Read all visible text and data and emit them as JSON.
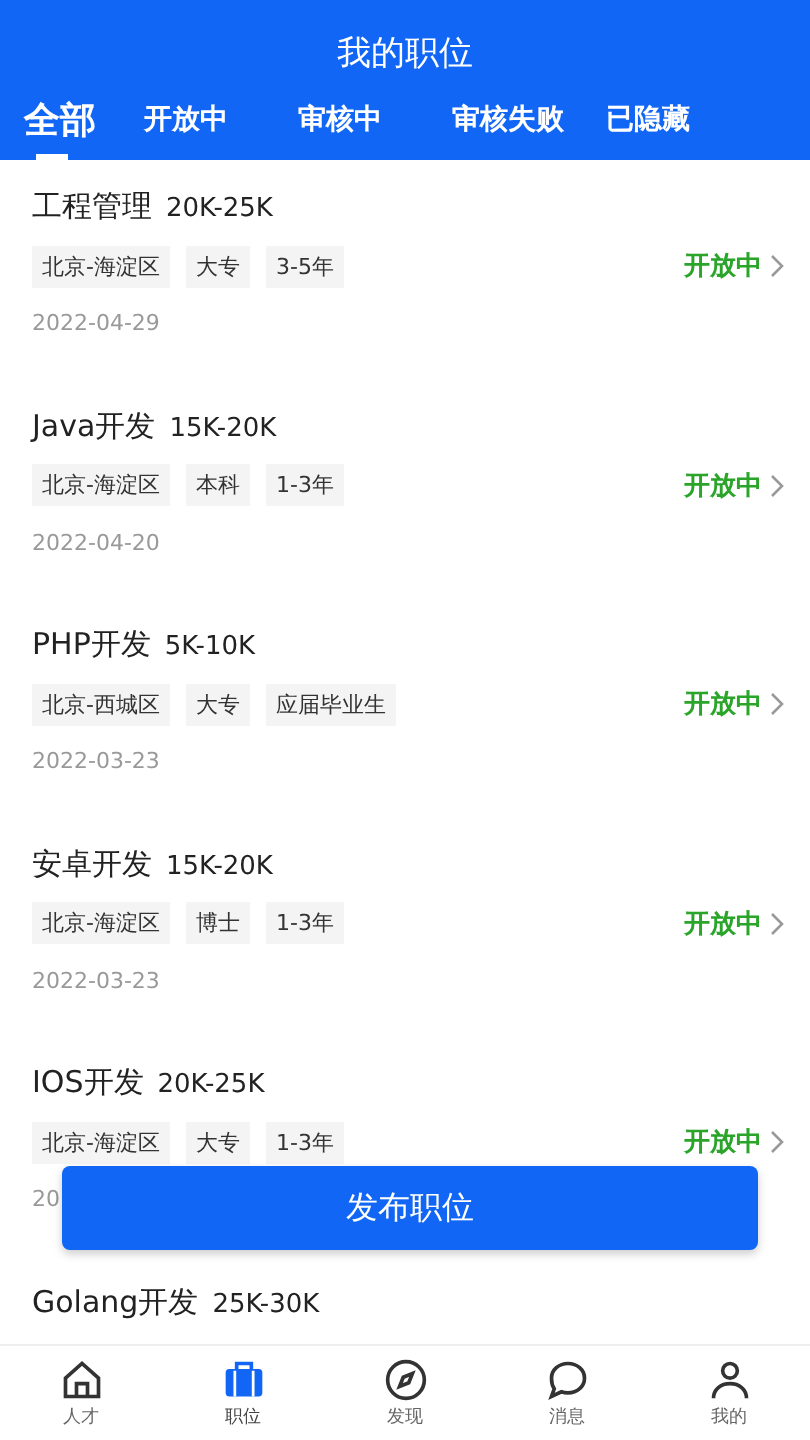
{
  "header": {
    "title": "我的职位"
  },
  "tabs": [
    {
      "label": "全部",
      "selected": true
    },
    {
      "label": "开放中",
      "selected": false
    },
    {
      "label": "审核中",
      "selected": false
    },
    {
      "label": "审核失败",
      "selected": false
    },
    {
      "label": "已隐藏",
      "selected": false
    }
  ],
  "jobs": [
    {
      "title": "工程管理",
      "salary": "20K-25K",
      "tags": [
        "北京-海淀区",
        "大专",
        "3-5年"
      ],
      "status": "开放中",
      "date": "2022-04-29"
    },
    {
      "title": "Java开发",
      "salary": "15K-20K",
      "tags": [
        "北京-海淀区",
        "本科",
        "1-3年"
      ],
      "status": "开放中",
      "date": "2022-04-20"
    },
    {
      "title": "PHP开发",
      "salary": "5K-10K",
      "tags": [
        "北京-西城区",
        "大专",
        "应届毕业生"
      ],
      "status": "开放中",
      "date": "2022-03-23"
    },
    {
      "title": "安卓开发",
      "salary": "15K-20K",
      "tags": [
        "北京-海淀区",
        "博士",
        "1-3年"
      ],
      "status": "开放中",
      "date": "2022-03-23"
    },
    {
      "title": "IOS开发",
      "salary": "20K-25K",
      "tags": [
        "北京-海淀区",
        "大专",
        "1-3年"
      ],
      "status": "开放中",
      "date": "20"
    },
    {
      "title": "Golang开发",
      "salary": "25K-30K"
    }
  ],
  "publish_button": "发布职位",
  "nav": [
    {
      "kind": "home",
      "label": "人才",
      "selected": false
    },
    {
      "kind": "briefcase",
      "label": "职位",
      "selected": true
    },
    {
      "kind": "compass",
      "label": "发现",
      "selected": false
    },
    {
      "kind": "chat",
      "label": "消息",
      "selected": false
    },
    {
      "kind": "user",
      "label": "我的",
      "selected": false
    }
  ]
}
